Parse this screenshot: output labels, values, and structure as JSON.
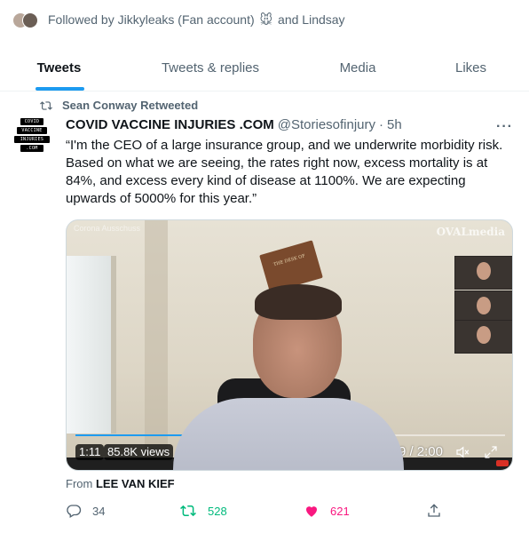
{
  "social_context": {
    "prefix": "Followed by",
    "name1": "Jikkyleaks (Fan account)",
    "emoji": "🐭",
    "suffix": "and Lindsay"
  },
  "tabs": [
    {
      "label": "Tweets",
      "active": true
    },
    {
      "label": "Tweets & replies",
      "active": false
    },
    {
      "label": "Media",
      "active": false
    },
    {
      "label": "Likes",
      "active": false
    }
  ],
  "tweet": {
    "retweeted_by": "Sean Conway Retweeted",
    "avatar_lines": [
      "COVID",
      "VACCINE",
      "INJURIES",
      ".COM"
    ],
    "author_name": "COVID VACCINE INJURIES .COM",
    "handle": "@Storiesofinjury",
    "separator": "·",
    "time": "5h",
    "more": "···",
    "text": "“I'm the CEO of a large insurance group, and we underwrite morbidity risk. Based on what we are seeing, the rates right now, excess mortality is at 84%, and excess every kind of disease at 1100%. We are expecting upwards of 5000% for this year.”",
    "media": {
      "watermark_left": "Corona Ausschuss",
      "watermark_right": "OVALmedia",
      "plaque_text": "THE DESK OF",
      "elapsed": "1:11",
      "views": "85.8K views",
      "position": "0:49 / 2:00",
      "progress": 0.41
    },
    "from_label": "From",
    "from_name": "LEE VAN KIEF",
    "replies": "34",
    "retweets": "528",
    "likes": "621",
    "colors": {
      "retweet": "#00ba7c",
      "like": "#f91880",
      "accent": "#1d9bf0",
      "muted": "#536471"
    }
  }
}
